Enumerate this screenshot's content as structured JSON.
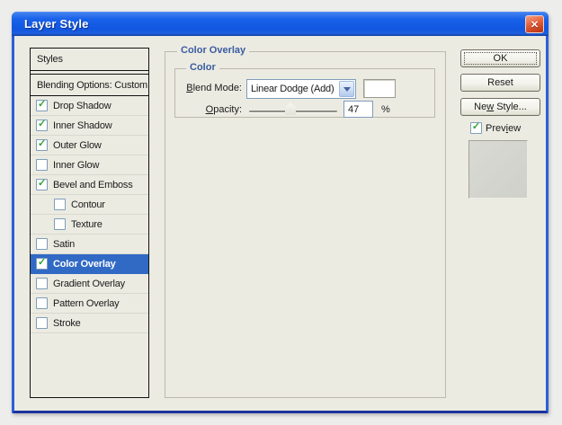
{
  "window": {
    "title": "Layer Style",
    "close_icon": "✕"
  },
  "sidebar": {
    "header": "Styles",
    "blending_header": "Blending Options: Custom",
    "items": [
      {
        "label": "Drop Shadow",
        "check": "✓",
        "indent": false,
        "selected": false
      },
      {
        "label": "Inner Shadow",
        "check": "✓",
        "indent": false,
        "selected": false
      },
      {
        "label": "Outer Glow",
        "check": "✓",
        "indent": false,
        "selected": false
      },
      {
        "label": "Inner Glow",
        "check": "",
        "indent": false,
        "selected": false
      },
      {
        "label": "Bevel and Emboss",
        "check": "✓",
        "indent": false,
        "selected": false
      },
      {
        "label": "Contour",
        "check": "",
        "indent": true,
        "selected": false
      },
      {
        "label": "Texture",
        "check": "",
        "indent": true,
        "selected": false
      },
      {
        "label": "Satin",
        "check": "",
        "indent": false,
        "selected": false
      },
      {
        "label": "Color Overlay",
        "check": "✓",
        "indent": false,
        "selected": true
      },
      {
        "label": "Gradient Overlay",
        "check": "",
        "indent": false,
        "selected": false
      },
      {
        "label": "Pattern Overlay",
        "check": "",
        "indent": false,
        "selected": false
      },
      {
        "label": "Stroke",
        "check": "",
        "indent": false,
        "selected": false
      }
    ]
  },
  "main": {
    "group_title": "Color Overlay",
    "subgroup_title": "Color",
    "blend_mode": {
      "label_accel": "B",
      "label_rest": "lend Mode:",
      "value": "Linear Dodge (Add)",
      "swatch_color": "#FFFFFF"
    },
    "opacity": {
      "label_accel": "O",
      "label_rest": "pacity:",
      "value": "47",
      "unit": "%"
    }
  },
  "actions": {
    "ok": "OK",
    "reset": "Reset",
    "new_style": {
      "pre": "Ne",
      "accel": "w",
      "post": " Style..."
    },
    "preview": {
      "pre": "Prev",
      "accel": "i",
      "post": "ew",
      "check": "✓"
    }
  },
  "colors": {
    "titlebar_blue": "#1A62EA",
    "dialog_border_blue": "#2C5FD9",
    "dialog_bg": "#ECEBE2",
    "selection_blue": "#316AC5",
    "label_blue": "#3A5C9F",
    "check_green": "#2FA435",
    "close_red": "#D8532F",
    "input_border_blue": "#7F9DB9"
  }
}
